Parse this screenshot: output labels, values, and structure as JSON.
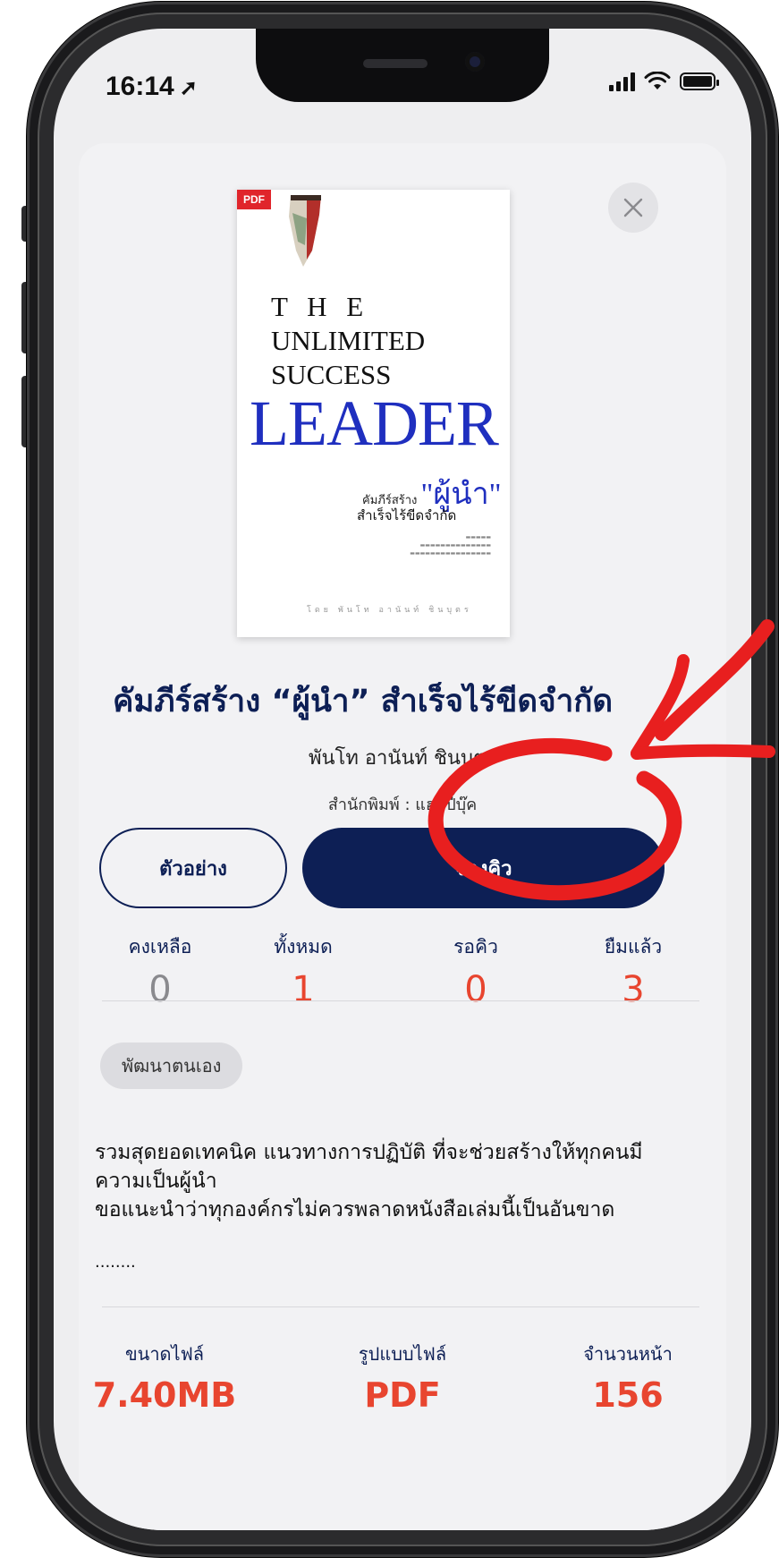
{
  "status_bar": {
    "time": "16:14",
    "location_glyph": "➚"
  },
  "book": {
    "cover": {
      "badge": "PDF",
      "line1": "T H E",
      "line2": "UNLIMITED",
      "line3": "SUCCESS",
      "line4": "LEADER",
      "subtitle_prefix": "คัมภีร์สร้าง",
      "subtitle_big": "\"ผู้นำ\"",
      "subtitle_line2": "สำเร็จไร้ขีดจำกัด",
      "author_line": "โดย  พันโท อานันท์ ชินบุตร"
    },
    "title": "คัมภีร์สร้าง “ผู้นำ” สำเร็จไร้ขีดจำกัด",
    "author": "พันโท อานันท์ ชินบุตร",
    "publisher": "สำนักพิมพ์ : แฮปปี้บุ๊ค"
  },
  "buttons": {
    "preview": "ตัวอย่าง",
    "reserve": "จองคิว"
  },
  "stats": [
    {
      "label": "คงเหลือ",
      "value": "0",
      "color": "#8a8a8e"
    },
    {
      "label": "ทั้งหมด",
      "value": "1",
      "color": "#e8452f"
    },
    {
      "label": "รอคิว",
      "value": "0",
      "color": "#e8452f"
    },
    {
      "label": "ยืมแล้ว",
      "value": "3",
      "color": "#e8452f"
    }
  ],
  "category": "พัฒนาตนเอง",
  "description": "รวมสุดยอดเทคนิค แนวทางการปฏิบัติ ที่จะช่วยสร้างให้ทุกคนมีความเป็นผู้นำ\nขอแนะนำว่าทุกองค์กรไม่ควรพลาดหนังสือเล่มนี้เป็นอันขาด",
  "description_more": "........",
  "meta": [
    {
      "label": "ขนาดไฟล์",
      "value": "7.40MB"
    },
    {
      "label": "รูปแบบไฟล์",
      "value": "PDF"
    },
    {
      "label": "จำนวนหน้า",
      "value": "156"
    }
  ],
  "colors": {
    "primary": "#0d1f55",
    "accent": "#e8452f",
    "annotation": "#e81f1f"
  }
}
